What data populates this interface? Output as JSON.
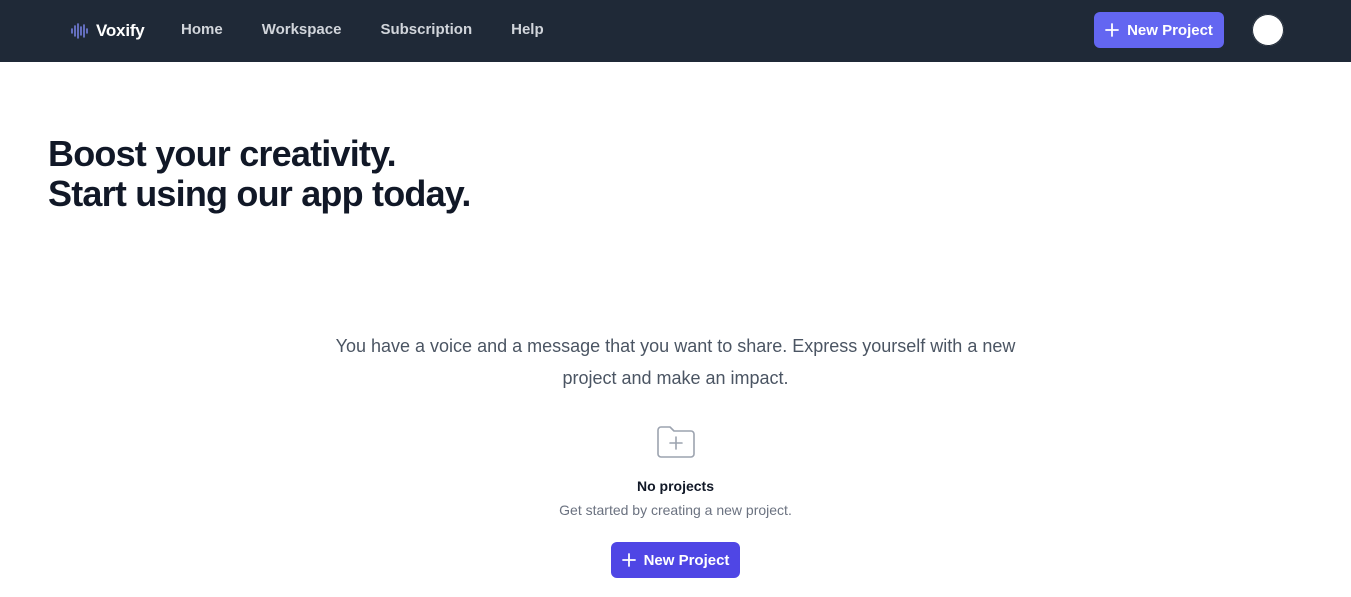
{
  "nav": {
    "brand": "Voxify",
    "brand_icon": "sound-wave-icon",
    "links": [
      "Home",
      "Workspace",
      "Subscription",
      "Help"
    ],
    "new_project_label": "New Project",
    "avatar_icon": "user-avatar"
  },
  "hero": {
    "line1": "Boost your creativity.",
    "line2": "Start using our app today."
  },
  "main": {
    "tagline": "You have a voice and a message that you want to share. Express yourself with a new project and make an impact.",
    "empty_icon": "folder-plus-icon",
    "empty_title": "No projects",
    "empty_subtitle": "Get started by creating a new project.",
    "new_project_label": "New Project"
  },
  "colors": {
    "navbar_bg": "#1f2937",
    "accent": "#6366f1",
    "accent_dark": "#4f46e5",
    "heading": "#111827",
    "body_text": "#4b5563"
  }
}
